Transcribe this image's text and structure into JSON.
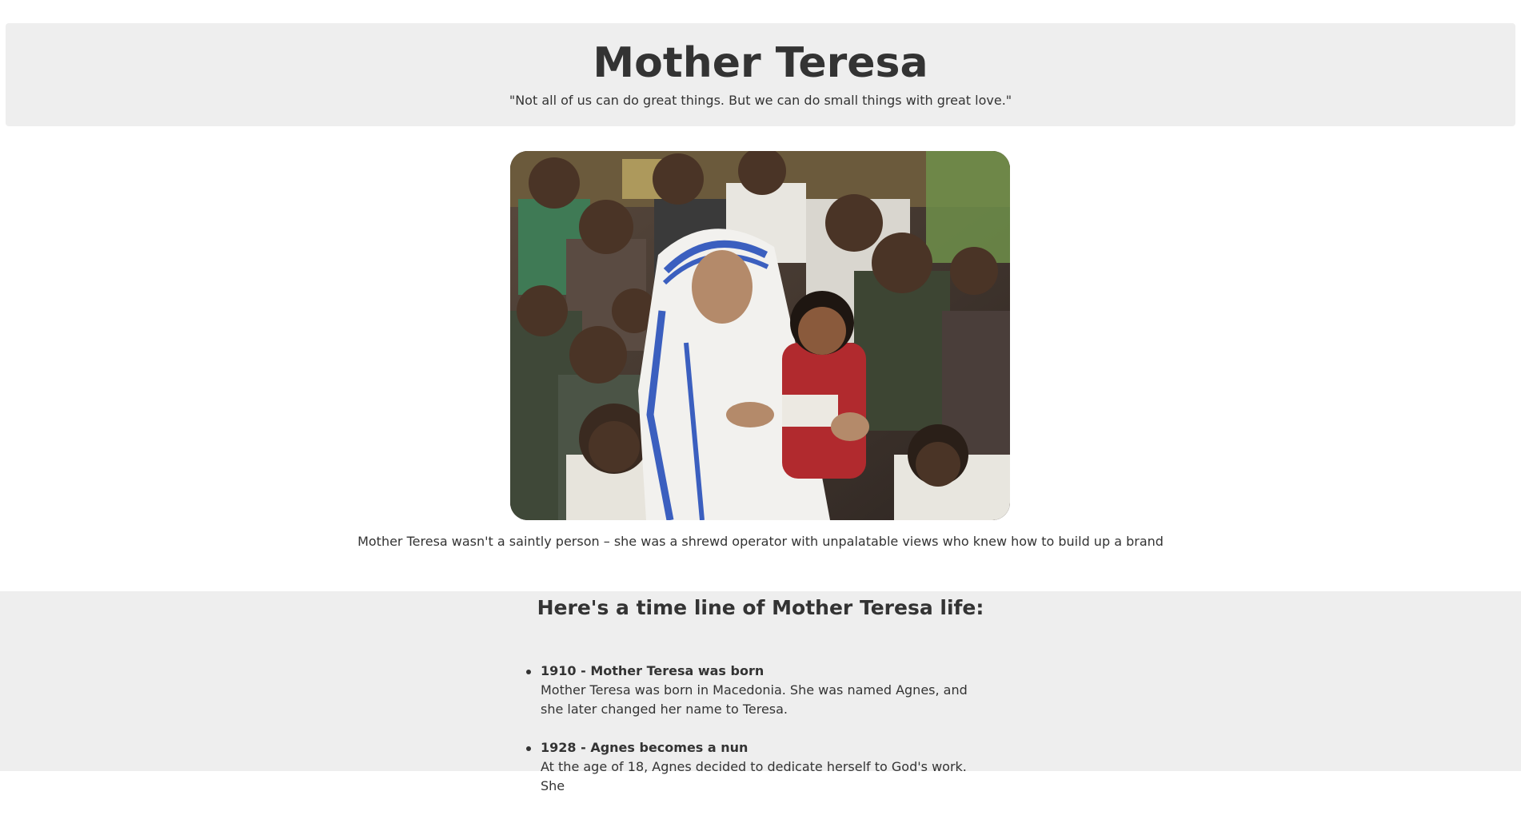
{
  "header": {
    "title": "Mother Teresa",
    "quote": "\"Not all of us can do great things. But we can do small things with great love.\""
  },
  "photo": {
    "alt": "Mother Teresa holding a child surrounded by children"
  },
  "caption": "Mother Teresa wasn't a saintly person – she was a shrewd operator with unpalatable views who knew how to build up a brand",
  "timeline": {
    "heading": "Here's a time line of Mother Teresa life:",
    "items": [
      {
        "title": "1910 - Mother Teresa was born",
        "text": "Mother Teresa was born in Macedonia. She was named Agnes, and she later changed her name to Teresa."
      },
      {
        "title": "1928 - Agnes becomes a nun",
        "text": "At the age of 18, Agnes decided to dedicate herself to God's work. She"
      }
    ]
  },
  "colors": {
    "panel_bg": "#eeeeee",
    "text": "#333333",
    "habit_blue": "#3b5fbf"
  }
}
